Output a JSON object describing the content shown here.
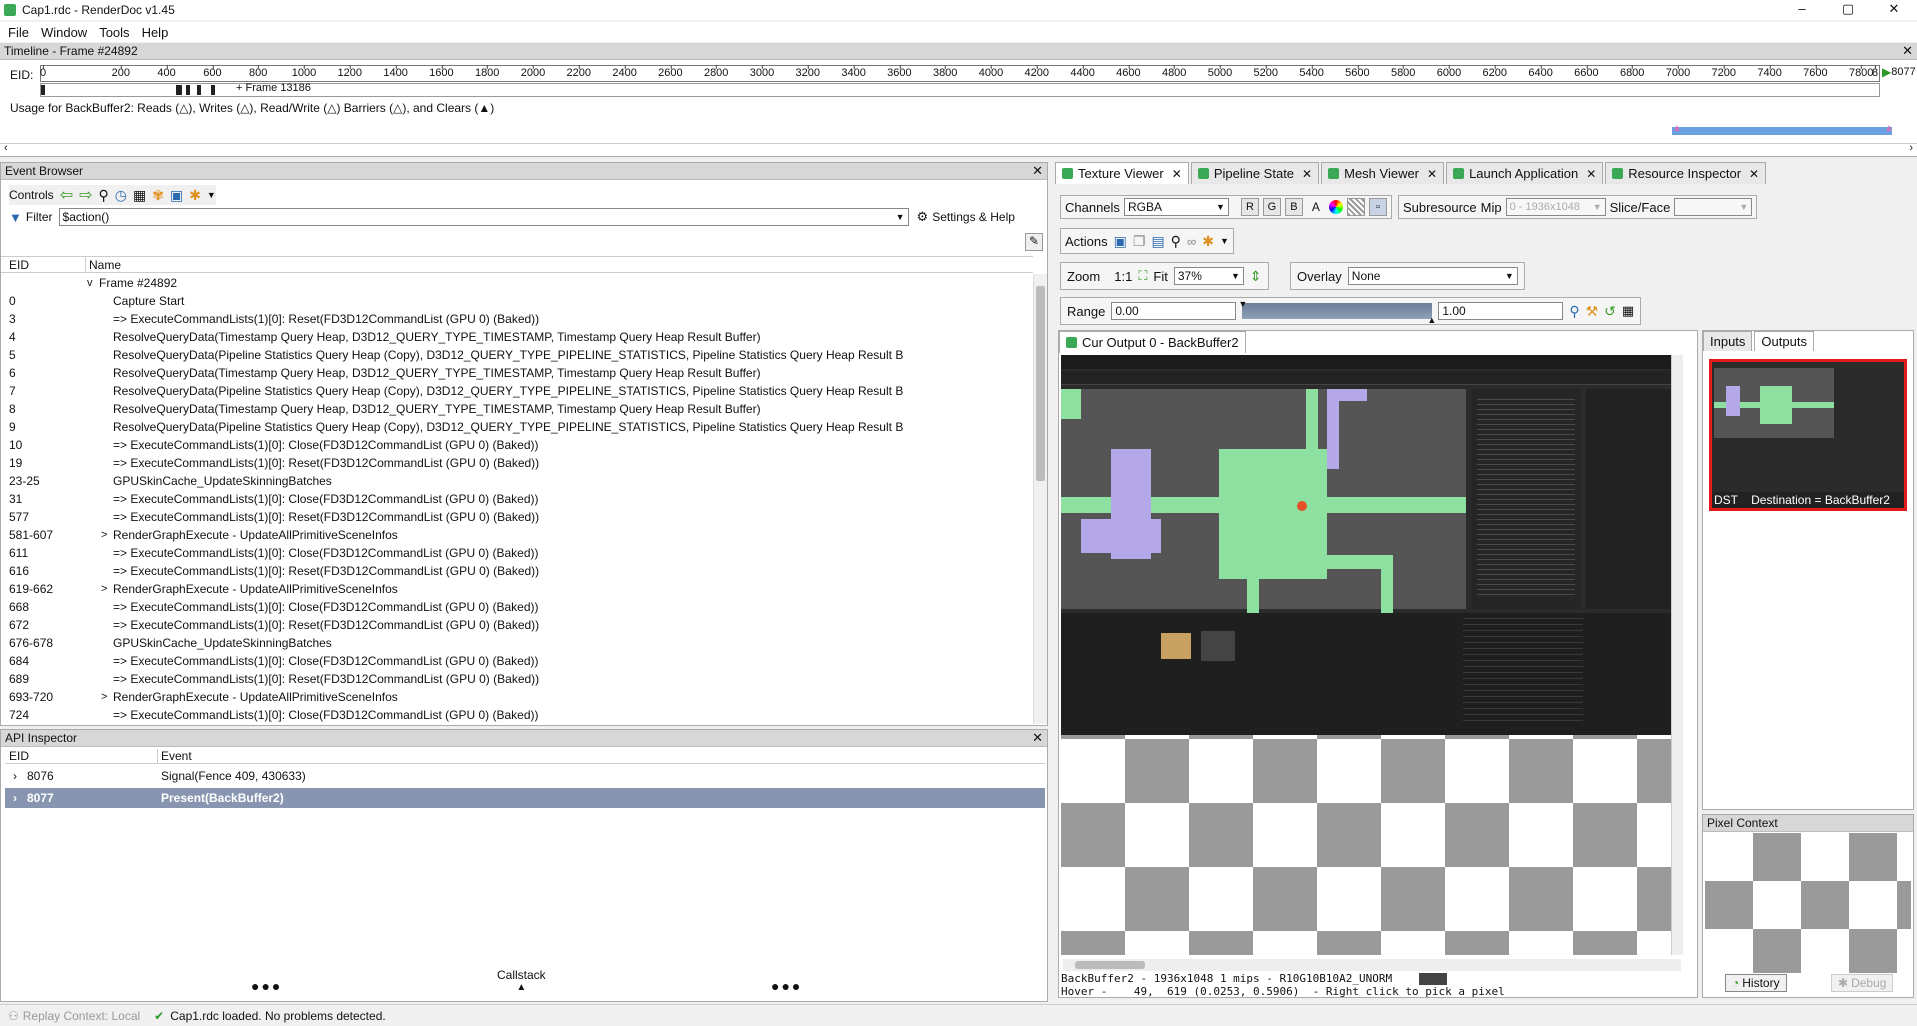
{
  "window": {
    "title": "Cap1.rdc - RenderDoc v1.45",
    "min": "–",
    "max": "▢",
    "close": "✕"
  },
  "menu": [
    "File",
    "Window",
    "Tools",
    "Help"
  ],
  "timeline": {
    "title": "Timeline - Frame #24892",
    "eid_label": "EID:",
    "ticks": [
      "0",
      "200",
      "400",
      "600",
      "800",
      "1000",
      "1200",
      "1400",
      "1600",
      "1800",
      "2000",
      "2200",
      "2400",
      "2600",
      "2800",
      "3000",
      "3200",
      "3400",
      "3600",
      "3800",
      "4000",
      "4200",
      "4400",
      "4600",
      "4800",
      "5000",
      "5200",
      "5400",
      "5600",
      "5800",
      "6000",
      "6200",
      "6400",
      "6600",
      "6800",
      "7000",
      "7200",
      "7400",
      "7600",
      "7800",
      "8"
    ],
    "end_marker": "8077",
    "frame_marker": "+ Frame 13186",
    "usage_text": "Usage for BackBuffer2: Reads (△), Writes (△), Read/Write (△) Barriers (△), and Clears (▲)"
  },
  "event_browser": {
    "title": "Event Browser",
    "controls_label": "Controls",
    "filter_label": "Filter",
    "filter_value": "$action()",
    "settings_label": "Settings & Help",
    "col_eid": "EID",
    "col_name": "Name",
    "rows": [
      {
        "eid": "",
        "name": "Frame #24892",
        "indent": 0,
        "expander": "v"
      },
      {
        "eid": "0",
        "name": "Capture Start",
        "indent": 1,
        "expander": ""
      },
      {
        "eid": "3",
        "name": "=> ExecuteCommandLists(1)[0]: Reset(FD3D12CommandList (GPU 0) (Baked))",
        "indent": 1,
        "expander": ""
      },
      {
        "eid": "4",
        "name": "ResolveQueryData(Timestamp Query Heap, D3D12_QUERY_TYPE_TIMESTAMP, Timestamp Query Heap Result Buffer)",
        "indent": 1,
        "expander": ""
      },
      {
        "eid": "5",
        "name": "ResolveQueryData(Pipeline Statistics Query Heap (Copy), D3D12_QUERY_TYPE_PIPELINE_STATISTICS, Pipeline Statistics Query Heap Result B",
        "indent": 1,
        "expander": ""
      },
      {
        "eid": "6",
        "name": "ResolveQueryData(Timestamp Query Heap, D3D12_QUERY_TYPE_TIMESTAMP, Timestamp Query Heap Result Buffer)",
        "indent": 1,
        "expander": ""
      },
      {
        "eid": "7",
        "name": "ResolveQueryData(Pipeline Statistics Query Heap (Copy), D3D12_QUERY_TYPE_PIPELINE_STATISTICS, Pipeline Statistics Query Heap Result B",
        "indent": 1,
        "expander": ""
      },
      {
        "eid": "8",
        "name": "ResolveQueryData(Timestamp Query Heap, D3D12_QUERY_TYPE_TIMESTAMP, Timestamp Query Heap Result Buffer)",
        "indent": 1,
        "expander": ""
      },
      {
        "eid": "9",
        "name": "ResolveQueryData(Pipeline Statistics Query Heap (Copy), D3D12_QUERY_TYPE_PIPELINE_STATISTICS, Pipeline Statistics Query Heap Result B",
        "indent": 1,
        "expander": ""
      },
      {
        "eid": "10",
        "name": "=> ExecuteCommandLists(1)[0]: Close(FD3D12CommandList (GPU 0) (Baked))",
        "indent": 1,
        "expander": ""
      },
      {
        "eid": "19",
        "name": "=> ExecuteCommandLists(1)[0]: Reset(FD3D12CommandList (GPU 0) (Baked))",
        "indent": 1,
        "expander": ""
      },
      {
        "eid": "23-25",
        "name": "GPUSkinCache_UpdateSkinningBatches",
        "indent": 1,
        "expander": ""
      },
      {
        "eid": "31",
        "name": "=> ExecuteCommandLists(1)[0]: Close(FD3D12CommandList (GPU 0) (Baked))",
        "indent": 1,
        "expander": ""
      },
      {
        "eid": "577",
        "name": "=> ExecuteCommandLists(1)[0]: Reset(FD3D12CommandList (GPU 0) (Baked))",
        "indent": 1,
        "expander": ""
      },
      {
        "eid": "581-607",
        "name": "RenderGraphExecute - UpdateAllPrimitiveSceneInfos",
        "indent": 1,
        "expander": ">"
      },
      {
        "eid": "611",
        "name": "=> ExecuteCommandLists(1)[0]: Close(FD3D12CommandList (GPU 0) (Baked))",
        "indent": 1,
        "expander": ""
      },
      {
        "eid": "616",
        "name": "=> ExecuteCommandLists(1)[0]: Reset(FD3D12CommandList (GPU 0) (Baked))",
        "indent": 1,
        "expander": ""
      },
      {
        "eid": "619-662",
        "name": "RenderGraphExecute - UpdateAllPrimitiveSceneInfos",
        "indent": 1,
        "expander": ">"
      },
      {
        "eid": "668",
        "name": "=> ExecuteCommandLists(1)[0]: Close(FD3D12CommandList (GPU 0) (Baked))",
        "indent": 1,
        "expander": ""
      },
      {
        "eid": "672",
        "name": "=> ExecuteCommandLists(1)[0]: Reset(FD3D12CommandList (GPU 0) (Baked))",
        "indent": 1,
        "expander": ""
      },
      {
        "eid": "676-678",
        "name": "GPUSkinCache_UpdateSkinningBatches",
        "indent": 1,
        "expander": ""
      },
      {
        "eid": "684",
        "name": "=> ExecuteCommandLists(1)[0]: Close(FD3D12CommandList (GPU 0) (Baked))",
        "indent": 1,
        "expander": ""
      },
      {
        "eid": "689",
        "name": "=> ExecuteCommandLists(1)[0]: Reset(FD3D12CommandList (GPU 0) (Baked))",
        "indent": 1,
        "expander": ""
      },
      {
        "eid": "693-720",
        "name": "RenderGraphExecute - UpdateAllPrimitiveSceneInfos",
        "indent": 1,
        "expander": ">"
      },
      {
        "eid": "724",
        "name": "=> ExecuteCommandLists(1)[0]: Close(FD3D12CommandList (GPU 0) (Baked))",
        "indent": 1,
        "expander": ""
      }
    ]
  },
  "api_inspector": {
    "title": "API Inspector",
    "col_eid": "EID",
    "col_event": "Event",
    "rows": [
      {
        "eid": "8076",
        "event": "Signal(Fence 409, 430633)",
        "selected": false
      },
      {
        "eid": "8077",
        "event": "Present(BackBuffer2)",
        "selected": true
      }
    ],
    "callstack_label": "Callstack"
  },
  "tabs": [
    "Texture Viewer",
    "Pipeline State",
    "Mesh Viewer",
    "Launch Application",
    "Resource Inspector"
  ],
  "texture_viewer": {
    "channels_label": "Channels",
    "channels_value": "RGBA",
    "r": "R",
    "g": "G",
    "b": "B",
    "a": "A",
    "subresource_label": "Subresource",
    "mip_label": "Mip",
    "mip_value": "0 - 1936x1048",
    "slice_label": "Slice/Face",
    "actions_label": "Actions",
    "zoom_label": "Zoom",
    "zoom_1to1": "1:1",
    "fit_label": "Fit",
    "zoom_value": "37%",
    "overlay_label": "Overlay",
    "overlay_value": "None",
    "range_label": "Range",
    "range_min": "0.00",
    "range_max": "1.00",
    "output_tab": "Cur Output 0 - BackBuffer2",
    "info_line1": "BackBuffer2 - 1936x1048 1 mips - R10G10B10A2_UNORM",
    "info_line2": "Hover -    49,  619 (0.0253, 0.5906)  - Right click to pick a pixel"
  },
  "side_panel": {
    "inputs_tab": "Inputs",
    "outputs_tab": "Outputs",
    "thumb_caption": "DST    Destination = BackBuffer2",
    "pixel_context_title": "Pixel Context",
    "history_btn": "History",
    "debug_btn": "Debug"
  },
  "status": {
    "replay_context": "Replay Context: Local",
    "message": "Cap1.rdc loaded. No problems detected."
  },
  "colors": {
    "accent": "#3aa855",
    "selection": "#8795b0",
    "thumb_border": "#e31b1b"
  },
  "icons": [
    "back-arrow-icon",
    "forward-arrow-icon",
    "find-icon",
    "time-icon",
    "bookmark-icon",
    "settings-icon",
    "save-icon",
    "gear-icon",
    "magnifier-icon",
    "wand-icon",
    "undo-icon"
  ]
}
